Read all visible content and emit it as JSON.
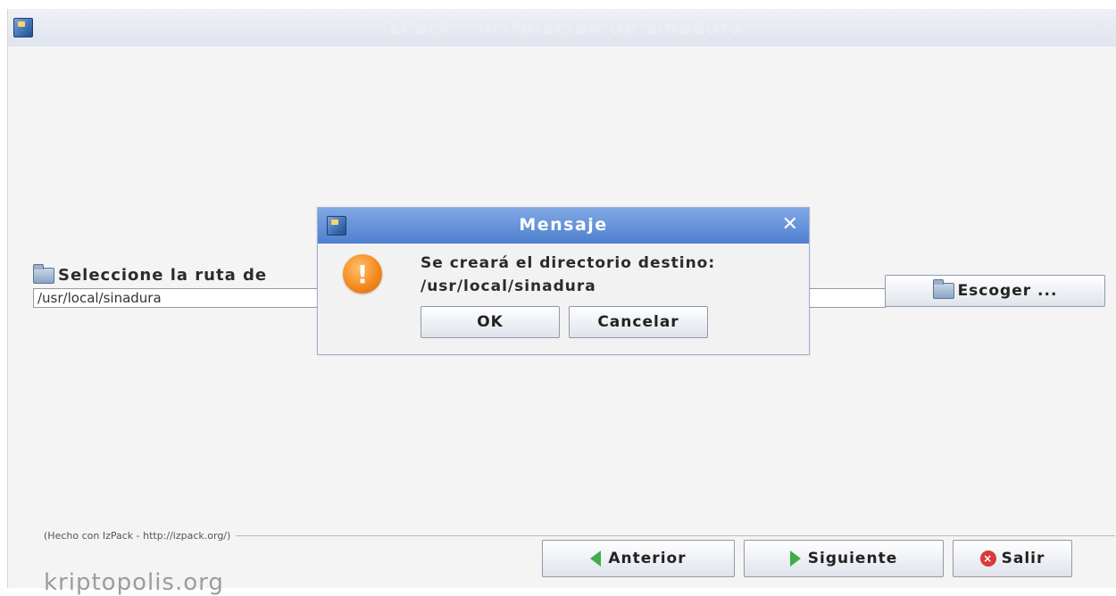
{
  "window": {
    "title": "IzPack - Instalación de sinadura",
    "minimize_glyph": "–",
    "close_glyph": "×"
  },
  "panel": {
    "label": "Seleccione la ruta de",
    "path_value": "/usr/local/sinadura",
    "choose_button": "Escoger ..."
  },
  "dialog": {
    "title": "Mensaje",
    "close_glyph": "✕",
    "message_line1": "Se creará el directorio destino:",
    "message_line2": "/usr/local/sinadura",
    "ok_button": "OK",
    "cancel_button": "Cancelar",
    "icon_glyph": "!"
  },
  "footer": {
    "credit": "(Hecho con IzPack - http://izpack.org/)",
    "prev_button": "Anterior",
    "next_button": "Siguiente",
    "exit_button": "Salir",
    "exit_glyph": "×"
  },
  "watermark": "kriptopolis.org",
  "colors": {
    "dialog_title": "#4f7fcf",
    "warning": "#f58a1f",
    "arrow": "#3eae48",
    "exit": "#d93b3b"
  }
}
